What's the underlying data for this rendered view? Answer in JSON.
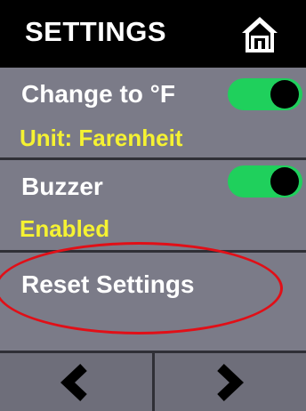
{
  "header": {
    "title": "SETTINGS",
    "home_icon": "home-icon"
  },
  "rows": [
    {
      "label": "Change to °F",
      "sub": "Unit: Farenheit",
      "toggle_on": true
    },
    {
      "label": "Buzzer",
      "sub": "Enabled",
      "toggle_on": true
    },
    {
      "label": "Reset Settings"
    }
  ],
  "footer": {
    "prev_icon": "chevron-left-icon",
    "next_icon": "chevron-right-icon"
  },
  "colors": {
    "background": "#7b7b88",
    "header": "#000000",
    "accent_text": "#f5f232",
    "toggle_on": "#1fd05c",
    "annotation": "#e10f17"
  }
}
